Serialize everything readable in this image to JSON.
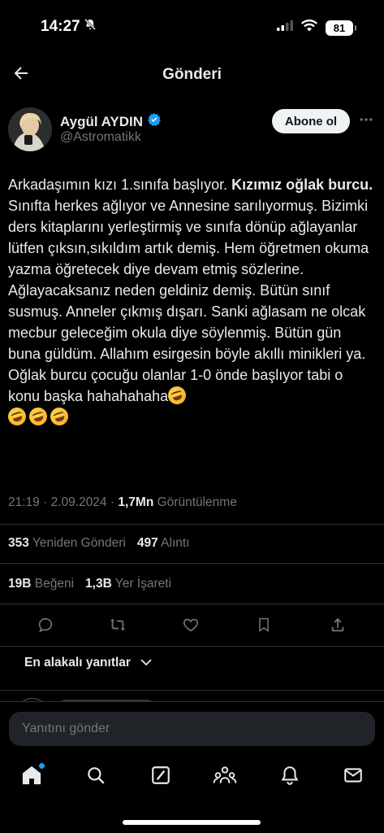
{
  "status_bar": {
    "time": "14:27",
    "battery": "81"
  },
  "header": {
    "title": "Gönderi"
  },
  "author": {
    "name": "Aygül AYDIN",
    "handle": "@Astromatikk",
    "follow_label": "Abone ol"
  },
  "post": {
    "text_before_bold": "Arkadaşımın kızı 1.sınıfa başlıyor. ",
    "text_bold": "Kızımız oğlak burcu.",
    "text_after_bold": " Sınıfta herkes ağlıyor ve Annesine sarılıyormuş. Bizimki ders kitaplarını yerleştirmiş ve sınıfa dönüp ağlayanlar lütfen çıksın,sıkıldım artık demiş. Hem öğretmen okuma yazma öğretecek diye devam etmiş sözlerine. Ağlayacaksanız neden geldiniz demiş. Bütün sınıf susmuş. Anneler çıkmış dışarı. Sanki ağlasam ne olcak mecbur geleceğim okula diye söylenmiş. Bütün gün buna güldüm. Allahım esirgesin böyle akıllı minikleri ya. Oğlak burcu çocuğu olanlar 1-0 önde başlıyor tabi o konu başka hahahahaha",
    "emoji_icon": "rolling-on-floor-laughing-emoji",
    "trailing_emoji_count": 3
  },
  "meta": {
    "time": "21:19",
    "separator": "·",
    "date": "2.09.2024",
    "separator2": "·",
    "views": "1,7Mn",
    "views_label": "Görüntülenme"
  },
  "stats": {
    "reposts": "353",
    "reposts_label": "Yeniden Gönderi",
    "quotes": "497",
    "quotes_label": "Alıntı",
    "likes": "19B",
    "likes_label": "Beğeni",
    "bookmarks": "1,3B",
    "bookmarks_label": "Yer İşareti"
  },
  "sort": {
    "label": "En alakalı yanıtlar"
  },
  "reply": {
    "placeholder": "Yanıtını gönder"
  },
  "tabs": [
    {
      "icon": "home-icon"
    },
    {
      "icon": "search-icon"
    },
    {
      "icon": "grok-icon"
    },
    {
      "icon": "communities-icon"
    },
    {
      "icon": "notifications-icon"
    },
    {
      "icon": "messages-icon"
    }
  ],
  "colors": {
    "background": "#000000",
    "text": "#e7e9ea",
    "muted": "#71767b",
    "verified": "#1d9bf0",
    "divider": "#2f3336"
  }
}
